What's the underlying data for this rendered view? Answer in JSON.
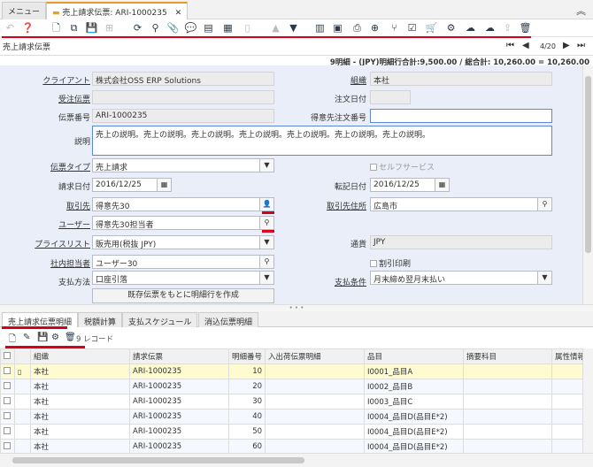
{
  "tabs": [
    {
      "label": "メニュー"
    },
    {
      "label": "売上請求伝票: ARI-1000235"
    }
  ],
  "window": {
    "title": "売上請求伝票",
    "page": "4/20"
  },
  "summary": "9明細 - (JPY)明細行合計:9,500.00 / 総合計: 10,260.00 = 10,260.00",
  "toolbar": {
    "icons": [
      "undo-icon",
      "help-icon",
      "new-record-icon",
      "copy-record-icon",
      "save-icon",
      "delete-disabled-icon",
      "refresh-icon",
      "find-icon",
      "attachment-icon",
      "chat-icon",
      "document-icon",
      "grid-toggle-icon",
      "detail-toggle-icon",
      "previous-record-icon",
      "next-record-icon",
      "report-icon",
      "archive-icon",
      "print-icon",
      "zoom-icon",
      "workflow-icon",
      "checklist-icon",
      "cart-icon",
      "process-gear-icon",
      "cloud-download-icon",
      "cloud-upload-icon",
      "export-icon",
      "trash-icon"
    ]
  },
  "form": {
    "client_label": "クライアント",
    "client_value": "株式会社OSS ERP Solutions",
    "org_label": "組織",
    "org_value": "本社",
    "order_label": "受注伝票",
    "order_value": "",
    "orderdate_label": "注文日付",
    "orderdate_value": "",
    "docno_label": "伝票番号",
    "docno_value": "ARI-1000235",
    "custorder_label": "得意先注文番号",
    "custorder_value": "",
    "desc_label": "説明",
    "desc_value": "売上の説明。売上の説明。売上の説明。売上の説明。売上の説明。売上の説明。売上の説明。",
    "doctype_label": "伝票タイプ",
    "doctype_value": "売上請求",
    "selfservice_label": "セルフサービス",
    "invdate_label": "請求日付",
    "invdate_value": "2016/12/25",
    "acctdate_label": "転記日付",
    "acctdate_value": "2016/12/25",
    "bpartner_label": "取引先",
    "bpartner_value": "得意先30",
    "location_label": "取引先住所",
    "location_value": "広島市",
    "user_label": "ユーザー",
    "user_value": "得意先30担当者",
    "pricelist_label": "プライスリスト",
    "pricelist_value": "販売用(税抜 JPY)",
    "currency_label": "通貨",
    "currency_value": "JPY",
    "salesrep_label": "社内担当者",
    "salesrep_value": "ユーザー30",
    "discountprint_label": "割引印刷",
    "payrule_label": "支払方法",
    "payrule_value": "口座引落",
    "payterm_label": "支払条件",
    "payterm_value": "月末締め翌月末払い",
    "create_lines_button": "既存伝票をもとに明細行を作成"
  },
  "subtabs": [
    "売上請求伝票明細",
    "税額計算",
    "支払スケジュール",
    "消込伝票明細"
  ],
  "subtoolbar": {
    "count": "9 レコード"
  },
  "grid": {
    "columns": [
      "",
      "組織",
      "請求伝票",
      "明細番号",
      "入出荷伝票明細",
      "品目",
      "摘要科目",
      "属性情報"
    ],
    "rows": [
      {
        "org": "本社",
        "invoice": "ARI-1000235",
        "line": "10",
        "shipment": "",
        "product": "I0001_品目A",
        "charge": "",
        "attr": ""
      },
      {
        "org": "本社",
        "invoice": "ARI-1000235",
        "line": "20",
        "shipment": "",
        "product": "I0002_品目B",
        "charge": "",
        "attr": ""
      },
      {
        "org": "本社",
        "invoice": "ARI-1000235",
        "line": "30",
        "shipment": "",
        "product": "I0003_品目C",
        "charge": "",
        "attr": ""
      },
      {
        "org": "本社",
        "invoice": "ARI-1000235",
        "line": "40",
        "shipment": "",
        "product": "I0004_品目D(品目E*2)",
        "charge": "",
        "attr": ""
      },
      {
        "org": "本社",
        "invoice": "ARI-1000235",
        "line": "50",
        "shipment": "",
        "product": "I0004_品目D(品目E*2)",
        "charge": "",
        "attr": ""
      },
      {
        "org": "本社",
        "invoice": "ARI-1000235",
        "line": "60",
        "shipment": "",
        "product": "I0004_品目D(品目E*2)",
        "charge": "",
        "attr": ""
      }
    ]
  }
}
